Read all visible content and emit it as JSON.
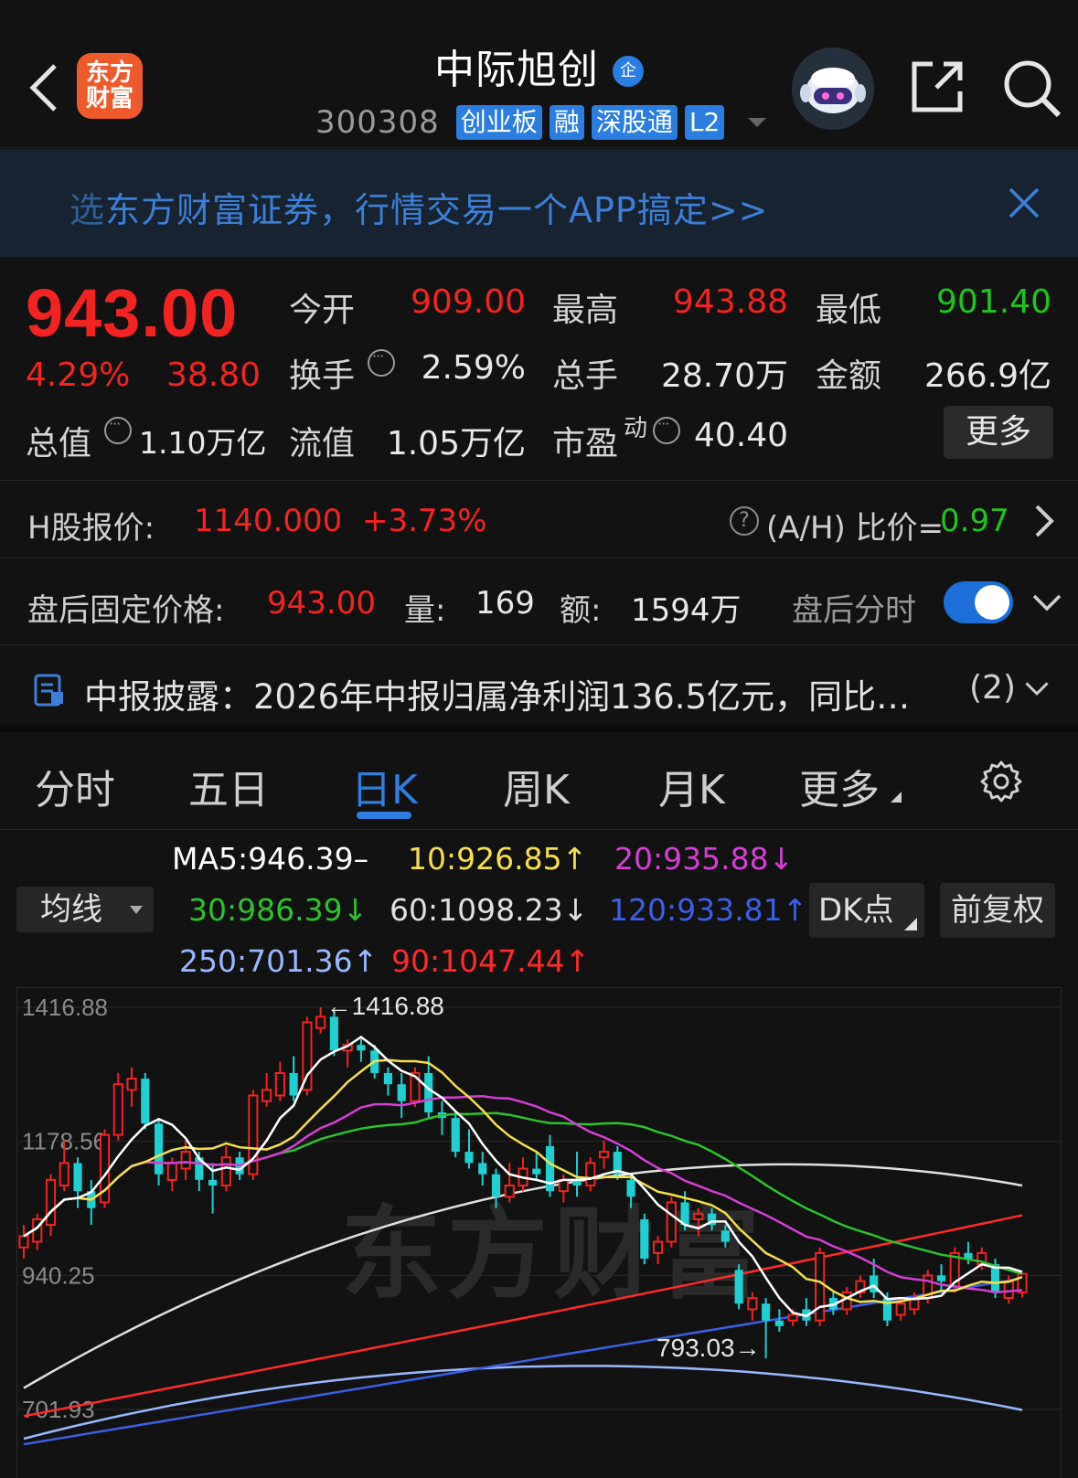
{
  "header": {
    "stock_name": "中际旭创",
    "name_badge": "企",
    "stock_code": "300308",
    "tags": [
      "创业板",
      "融",
      "深股通",
      "L2"
    ],
    "brand_logo_text_1": "东方",
    "brand_logo_text_2": "财富"
  },
  "banner": {
    "text_lead": "选",
    "text_rest": "东方财富证券，行情交易一个APP搞定>>"
  },
  "quote": {
    "price": "943.00",
    "change_pct": "4.29%",
    "change_amt": "38.80",
    "open_label": "今开",
    "open_value": "909.00",
    "high_label": "最高",
    "high_value": "943.88",
    "low_label": "最低",
    "low_value": "901.40",
    "turnover_label": "换手",
    "turnover_value": "2.59%",
    "volume_label": "总手",
    "volume_value": "28.70万",
    "amount_label": "金额",
    "amount_value": "266.9亿",
    "mktcap_label": "总值",
    "mktcap_value": "1.10万亿",
    "float_label": "流值",
    "float_value": "1.05万亿",
    "pe_label": "市盈",
    "pe_sup": "动",
    "pe_value": "40.40",
    "more_label": "更多"
  },
  "h_share": {
    "label": "H股报价:",
    "price": "1140.000",
    "change": "+3.73%",
    "ah_label": "(A/H) 比价=",
    "ah_value": "0.97"
  },
  "after_hours": {
    "label": "盘后固定价格:",
    "price": "943.00",
    "vol_label": "量:",
    "vol_value": "169",
    "amt_label": "额:",
    "amt_value": "1594万",
    "toggle_label": "盘后分时",
    "toggle_on": true
  },
  "report": {
    "text": "中报披露：2026年中报归属净利润136.5亿元，同比…",
    "count": "(2)"
  },
  "tabs": [
    {
      "label": "分时"
    },
    {
      "label": "五日"
    },
    {
      "label": "日K",
      "active": true
    },
    {
      "label": "周K"
    },
    {
      "label": "月K"
    },
    {
      "label": "更多"
    }
  ],
  "ma": {
    "selector_label": "均线",
    "ma5": "MA5:946.39–",
    "ma10": "10:926.85↑",
    "ma20": "20:935.88↓",
    "ma30": "30:986.39↓",
    "ma60": "60:1098.23↓",
    "ma120": "120:933.81↑",
    "ma250": "250:701.36↑",
    "ma90": "90:1047.44↑",
    "dk_label": "DK点",
    "adjust_label": "前复权",
    "colors": {
      "ma5": "#ffffff",
      "ma10": "#f4e04d",
      "ma20": "#d43fd4",
      "ma30": "#2ec12e",
      "ma60": "#e0e0e0",
      "ma120": "#3c5fe6",
      "ma250": "#9ab8ff",
      "ma90": "#ff2a2a"
    }
  },
  "chart_data": {
    "type": "candlestick",
    "y_tick_labels": [
      "1416.88",
      "1178.56",
      "940.25",
      "701.93"
    ],
    "ylim": [
      701.93,
      1416.88
    ],
    "high_marker": "←1416.88",
    "low_marker": "793.03→",
    "watermark": "东方财富",
    "up_color": "#f32323",
    "down_color": "#1fd0d0",
    "candles": [
      {
        "o": 990,
        "h": 1030,
        "l": 970,
        "c": 1010
      },
      {
        "o": 1000,
        "h": 1050,
        "l": 985,
        "c": 1040
      },
      {
        "o": 1030,
        "h": 1120,
        "l": 1010,
        "c": 1110
      },
      {
        "o": 1100,
        "h": 1180,
        "l": 1090,
        "c": 1140
      },
      {
        "o": 1140,
        "h": 1150,
        "l": 1060,
        "c": 1090
      },
      {
        "o": 1090,
        "h": 1110,
        "l": 1030,
        "c": 1060
      },
      {
        "o": 1070,
        "h": 1200,
        "l": 1060,
        "c": 1190
      },
      {
        "o": 1190,
        "h": 1300,
        "l": 1180,
        "c": 1280
      },
      {
        "o": 1270,
        "h": 1310,
        "l": 1240,
        "c": 1290
      },
      {
        "o": 1290,
        "h": 1300,
        "l": 1200,
        "c": 1210
      },
      {
        "o": 1210,
        "h": 1220,
        "l": 1100,
        "c": 1120
      },
      {
        "o": 1110,
        "h": 1150,
        "l": 1090,
        "c": 1140
      },
      {
        "o": 1130,
        "h": 1180,
        "l": 1110,
        "c": 1160
      },
      {
        "o": 1150,
        "h": 1160,
        "l": 1090,
        "c": 1110
      },
      {
        "o": 1110,
        "h": 1140,
        "l": 1050,
        "c": 1100
      },
      {
        "o": 1100,
        "h": 1170,
        "l": 1090,
        "c": 1150
      },
      {
        "o": 1150,
        "h": 1160,
        "l": 1110,
        "c": 1120
      },
      {
        "o": 1120,
        "h": 1270,
        "l": 1110,
        "c": 1260
      },
      {
        "o": 1250,
        "h": 1300,
        "l": 1240,
        "c": 1270
      },
      {
        "o": 1260,
        "h": 1320,
        "l": 1250,
        "c": 1300
      },
      {
        "o": 1300,
        "h": 1330,
        "l": 1250,
        "c": 1260
      },
      {
        "o": 1270,
        "h": 1400,
        "l": 1260,
        "c": 1390
      },
      {
        "o": 1380,
        "h": 1417,
        "l": 1370,
        "c": 1400
      },
      {
        "o": 1400,
        "h": 1410,
        "l": 1330,
        "c": 1340
      },
      {
        "o": 1340,
        "h": 1360,
        "l": 1310,
        "c": 1350
      },
      {
        "o": 1350,
        "h": 1360,
        "l": 1320,
        "c": 1340
      },
      {
        "o": 1340,
        "h": 1350,
        "l": 1290,
        "c": 1300
      },
      {
        "o": 1300,
        "h": 1310,
        "l": 1260,
        "c": 1280
      },
      {
        "o": 1280,
        "h": 1300,
        "l": 1220,
        "c": 1250
      },
      {
        "o": 1250,
        "h": 1310,
        "l": 1240,
        "c": 1300
      },
      {
        "o": 1300,
        "h": 1330,
        "l": 1220,
        "c": 1230
      },
      {
        "o": 1230,
        "h": 1250,
        "l": 1190,
        "c": 1220
      },
      {
        "o": 1220,
        "h": 1230,
        "l": 1150,
        "c": 1160
      },
      {
        "o": 1160,
        "h": 1200,
        "l": 1130,
        "c": 1140
      },
      {
        "o": 1140,
        "h": 1160,
        "l": 1100,
        "c": 1120
      },
      {
        "o": 1120,
        "h": 1130,
        "l": 1060,
        "c": 1080
      },
      {
        "o": 1080,
        "h": 1140,
        "l": 1070,
        "c": 1100
      },
      {
        "o": 1100,
        "h": 1150,
        "l": 1090,
        "c": 1130
      },
      {
        "o": 1130,
        "h": 1160,
        "l": 1110,
        "c": 1120
      },
      {
        "o": 1170,
        "h": 1190,
        "l": 1080,
        "c": 1090
      },
      {
        "o": 1090,
        "h": 1120,
        "l": 1070,
        "c": 1110
      },
      {
        "o": 1110,
        "h": 1160,
        "l": 1080,
        "c": 1100
      },
      {
        "o": 1100,
        "h": 1150,
        "l": 1090,
        "c": 1140
      },
      {
        "o": 1150,
        "h": 1180,
        "l": 1130,
        "c": 1160
      },
      {
        "o": 1160,
        "h": 1170,
        "l": 1110,
        "c": 1120
      },
      {
        "o": 1110,
        "h": 1120,
        "l": 1060,
        "c": 1080
      },
      {
        "o": 1040,
        "h": 1050,
        "l": 960,
        "c": 970
      },
      {
        "o": 980,
        "h": 1010,
        "l": 960,
        "c": 1000
      },
      {
        "o": 1000,
        "h": 1080,
        "l": 990,
        "c": 1070
      },
      {
        "o": 1070,
        "h": 1090,
        "l": 1020,
        "c": 1030
      },
      {
        "o": 1040,
        "h": 1060,
        "l": 1010,
        "c": 1050
      },
      {
        "o": 1050,
        "h": 1060,
        "l": 1020,
        "c": 1030
      },
      {
        "o": 1020,
        "h": 1030,
        "l": 990,
        "c": 1000
      },
      {
        "o": 950,
        "h": 960,
        "l": 880,
        "c": 890
      },
      {
        "o": 880,
        "h": 910,
        "l": 860,
        "c": 900
      },
      {
        "o": 890,
        "h": 900,
        "l": 793,
        "c": 860
      },
      {
        "o": 860,
        "h": 880,
        "l": 840,
        "c": 850
      },
      {
        "o": 860,
        "h": 880,
        "l": 850,
        "c": 870
      },
      {
        "o": 880,
        "h": 900,
        "l": 850,
        "c": 860
      },
      {
        "o": 860,
        "h": 990,
        "l": 850,
        "c": 980
      },
      {
        "o": 900,
        "h": 910,
        "l": 870,
        "c": 880
      },
      {
        "o": 880,
        "h": 920,
        "l": 870,
        "c": 910
      },
      {
        "o": 910,
        "h": 940,
        "l": 900,
        "c": 930
      },
      {
        "o": 940,
        "h": 970,
        "l": 900,
        "c": 910
      },
      {
        "o": 900,
        "h": 910,
        "l": 850,
        "c": 860
      },
      {
        "o": 870,
        "h": 900,
        "l": 860,
        "c": 890
      },
      {
        "o": 880,
        "h": 910,
        "l": 870,
        "c": 900
      },
      {
        "o": 900,
        "h": 950,
        "l": 890,
        "c": 940
      },
      {
        "o": 940,
        "h": 960,
        "l": 910,
        "c": 930
      },
      {
        "o": 920,
        "h": 990,
        "l": 910,
        "c": 980
      },
      {
        "o": 980,
        "h": 1000,
        "l": 960,
        "c": 970
      },
      {
        "o": 960,
        "h": 990,
        "l": 950,
        "c": 980
      },
      {
        "o": 960,
        "h": 970,
        "l": 900,
        "c": 910
      },
      {
        "o": 900,
        "h": 940,
        "l": 890,
        "c": 930
      },
      {
        "o": 910,
        "h": 944,
        "l": 901,
        "c": 943
      }
    ]
  }
}
